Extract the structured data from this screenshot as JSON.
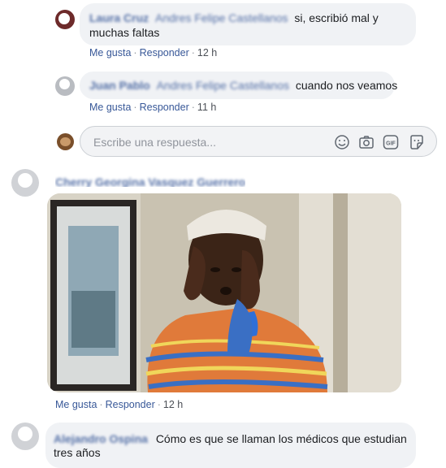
{
  "comments": [
    {
      "author": "Laura Cruz",
      "mention": "Andres Felipe Castellanos",
      "text": "si, escribió mal y",
      "text_line2": "muchas faltas",
      "actions": {
        "like": "Me gusta",
        "reply": "Responder",
        "time": "12 h"
      }
    },
    {
      "author": "Juan Pablo",
      "mention": "Andres Felipe Castellanos",
      "text": "cuando nos veamos",
      "actions": {
        "like": "Me gusta",
        "reply": "Responder",
        "time": "11 h"
      }
    },
    {
      "author": "Cherry Georgina Vasquez Guerrero",
      "actions": {
        "like": "Me gusta",
        "reply": "Responder",
        "time": "12 h"
      }
    },
    {
      "author": "Alejandro Ospina",
      "text": "Cómo es que se llaman los médicos que estudian",
      "text_line2": "tres años"
    }
  ],
  "reply_box": {
    "placeholder": "Escribe una respuesta...",
    "icons": [
      "emoji-icon",
      "camera-icon",
      "gif-icon",
      "sticker-icon"
    ]
  },
  "colors": {
    "link": "#385898",
    "bubble": "#f0f2f5",
    "meta": "#90949c"
  }
}
